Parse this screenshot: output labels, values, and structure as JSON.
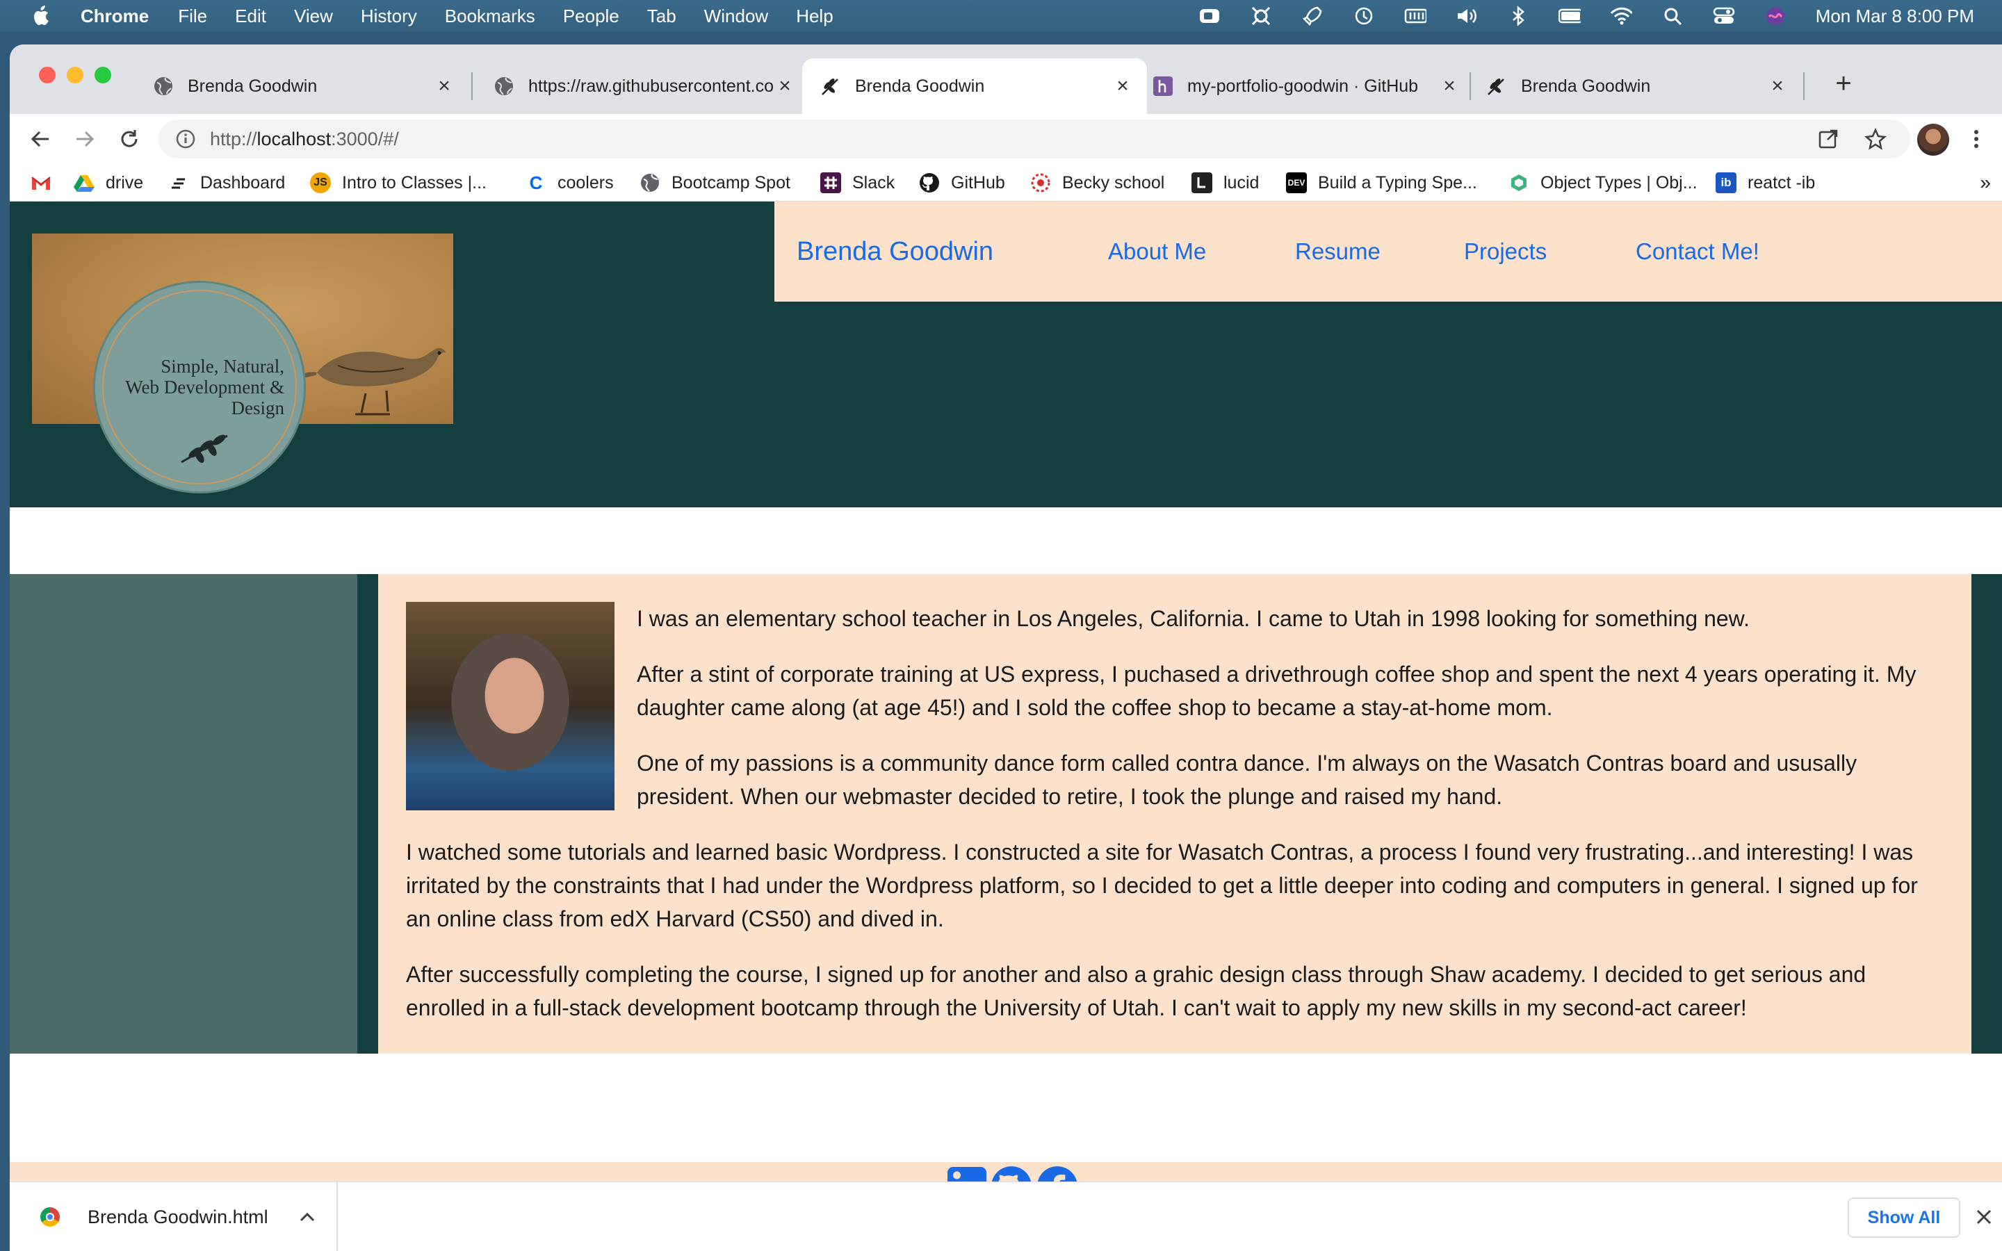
{
  "menubar": {
    "app": "Chrome",
    "items": [
      "File",
      "Edit",
      "View",
      "History",
      "Bookmarks",
      "People",
      "Tab",
      "Window",
      "Help"
    ],
    "clock": "Mon Mar 8  8:00 PM"
  },
  "tabs": [
    {
      "title": "Brenda Goodwin",
      "icon": "globe-icon"
    },
    {
      "title": "https://raw.githubusercontent.com",
      "icon": "globe-icon"
    },
    {
      "title": "Brenda Goodwin",
      "icon": "leaf-icon",
      "active": true
    },
    {
      "title": "my-portfolio-goodwin · GitHub",
      "icon": "heroku-icon"
    },
    {
      "title": "Brenda Goodwin",
      "icon": "leaf-icon"
    }
  ],
  "omnibox": {
    "url_prefix": "http://",
    "url_host": "localhost",
    "url_rest": ":3000/#/"
  },
  "bookmarks": [
    {
      "label": "",
      "icon": "gmail-icon"
    },
    {
      "label": "drive",
      "icon": "drive-icon"
    },
    {
      "label": "Dashboard",
      "icon": "dashboard-icon"
    },
    {
      "label": "Intro to Classes |...",
      "icon": "js-icon",
      "icon_text": "JS"
    },
    {
      "label": "coolers",
      "icon": "coolers-icon",
      "icon_text": "C"
    },
    {
      "label": "Bootcamp Spot",
      "icon": "globe-icon"
    },
    {
      "label": "Slack",
      "icon": "slack-icon"
    },
    {
      "label": "GitHub",
      "icon": "github-icon"
    },
    {
      "label": "Becky school",
      "icon": "school-icon"
    },
    {
      "label": "lucid",
      "icon": "lucid-icon"
    },
    {
      "label": "Build a Typing Spe...",
      "icon": "dev-icon",
      "icon_text": "DEV"
    },
    {
      "label": "Object Types | Obj...",
      "icon": "vue-icon"
    },
    {
      "label": "reatct -ib",
      "icon": "ib-icon",
      "icon_text": "ib"
    }
  ],
  "bookmarks_more": "»",
  "site": {
    "logo_text": [
      "Simple, Natural,",
      "Web Development &",
      "Design"
    ],
    "brand": "Brenda Goodwin",
    "nav": [
      "About Me",
      "Resume",
      "Projects",
      "Contact Me!"
    ],
    "about": [
      "I was an elementary school teacher in Los Angeles, California. I came to Utah in 1998 looking for something new.",
      "After a stint of corporate training at US express, I puchased a drivethrough coffee shop and spent the next 4 years operating it. My daughter came along (at age 45!) and I sold the coffee shop to became a stay-at-home mom.",
      "One of my passions is a community dance form called contra dance. I'm always on the Wasatch Contras board and ususally president. When our webmaster decided to retire, I took the plunge and raised my hand.",
      "I watched some tutorials and learned basic Wordpress. I constructed a site for Wasatch Contras, a process I found very frustrating...and interesting! I was irritated by the constraints that I had under the Wordpress platform, so I decided to get a little deeper into coding and computers in general. I signed up for an online class from edX Harvard (CS50) and dived in.",
      "After successfully completing the course, I signed up for another and also a grahic design class through Shaw academy. I decided to get serious and enrolled in a full-stack development bootcamp through the University of Utah. I can't wait to apply my new skills in my second-act career!"
    ],
    "social": [
      "linkedin-icon",
      "github-icon",
      "facebook-icon"
    ]
  },
  "downloads": {
    "file": "Brenda Goodwin.html",
    "show_all": "Show All"
  },
  "colors": {
    "header_bg": "#153e3e",
    "peach": "#fde2cb",
    "link_blue": "#1a6ae6",
    "side_panel": "#4e6b69"
  }
}
